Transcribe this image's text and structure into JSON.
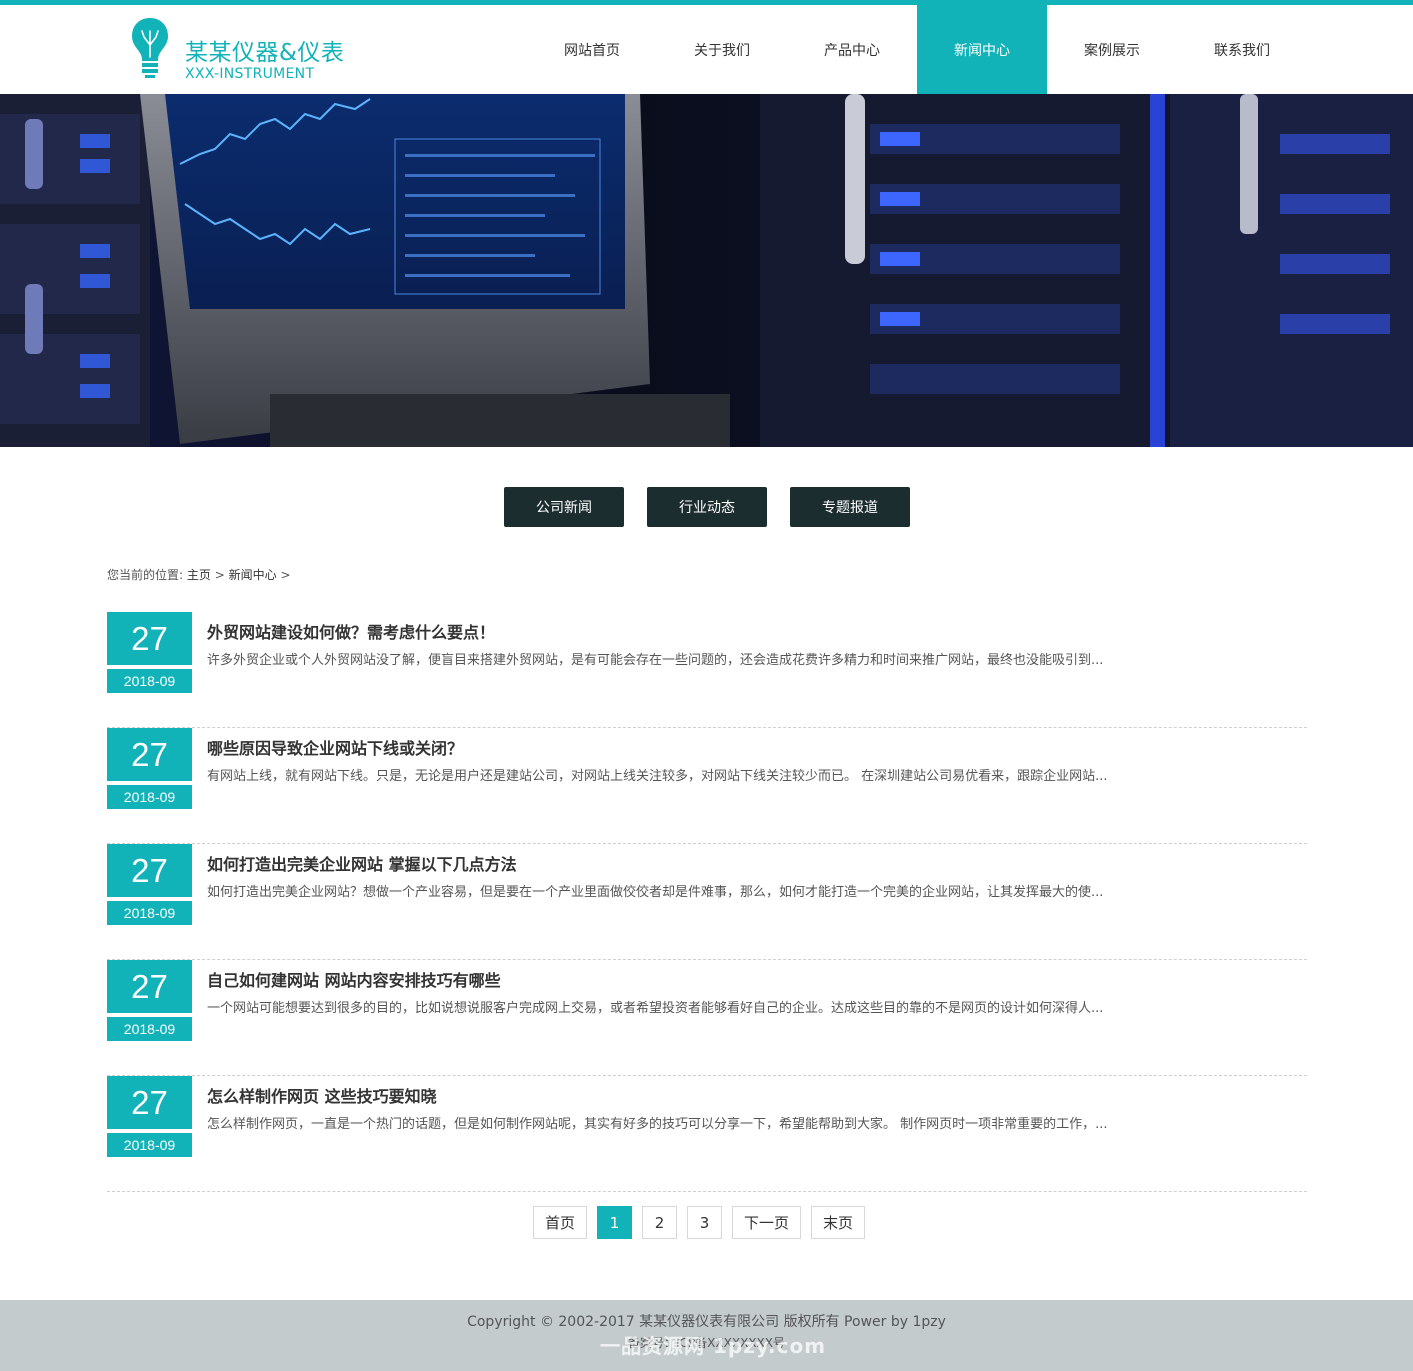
{
  "logo": {
    "name": "某某仪器&仪表",
    "sub": "XXX-INSTRUMENT"
  },
  "nav": [
    {
      "label": "网站首页"
    },
    {
      "label": "关于我们"
    },
    {
      "label": "产品中心"
    },
    {
      "label": "新闻中心",
      "active": true
    },
    {
      "label": "案例展示"
    },
    {
      "label": "联系我们"
    }
  ],
  "categories": [
    {
      "label": "公司新闻"
    },
    {
      "label": "行业动态"
    },
    {
      "label": "专题报道"
    }
  ],
  "breadcrumb": {
    "prefix": "您当前的位置:",
    "home": "主页",
    "sep1": ">",
    "current": "新闻中心",
    "sep2": ">"
  },
  "news": [
    {
      "day": "27",
      "month": "2018-09",
      "title": "外贸网站建设如何做？需考虑什么要点！",
      "summary": "许多外贸企业或个人外贸网站没了解，便盲目来搭建外贸网站，是有可能会存在一些问题的，还会造成花费许多精力和时间来推广网站，最终也没能吸引到..."
    },
    {
      "day": "27",
      "month": "2018-09",
      "title": "哪些原因导致企业网站下线或关闭？",
      "summary": "有网站上线，就有网站下线。只是，无论是用户还是建站公司，对网站上线关注较多，对网站下线关注较少而已。 在深圳建站公司易优看来，跟踪企业网站..."
    },
    {
      "day": "27",
      "month": "2018-09",
      "title": "如何打造出完美企业网站 掌握以下几点方法",
      "summary": "如何打造出完美企业网站？想做一个产业容易，但是要在一个产业里面做佼佼者却是件难事，那么，如何才能打造一个完美的企业网站，让其发挥最大的使..."
    },
    {
      "day": "27",
      "month": "2018-09",
      "title": "自己如何建网站 网站内容安排技巧有哪些",
      "summary": "一个网站可能想要达到很多的目的，比如说想说服客户完成网上交易，或者希望投资者能够看好自己的企业。达成这些目的靠的不是网页的设计如何深得人..."
    },
    {
      "day": "27",
      "month": "2018-09",
      "title": "怎么样制作网页 这些技巧要知晓",
      "summary": "怎么样制作网页，一直是一个热门的话题，但是如何制作网站呢，其实有好多的技巧可以分享一下，希望能帮助到大家。 制作网页时一项非常重要的工作，..."
    }
  ],
  "pager": {
    "first": "首页",
    "pages": [
      "1",
      "2",
      "3"
    ],
    "current": "1",
    "next": "下一页",
    "last": "末页"
  },
  "footer": {
    "copyright": "Copyright © 2002-2017 某某仪器仪表有限公司 版权所有 Power by 1pzy",
    "icp": "备案号：ICP备XXXXXXXX号",
    "watermark": "一品资源网 1pzy.com"
  },
  "colors": {
    "accent": "#12b3b8",
    "dark_button": "#1c2d30",
    "footer_bg": "#c3cbcc"
  }
}
